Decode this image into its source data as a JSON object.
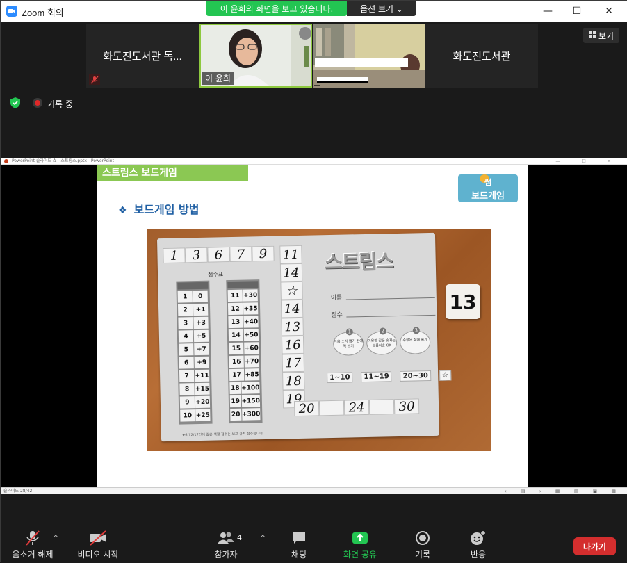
{
  "titlebar": {
    "app_title": "Zoom 회의",
    "share_banner": "이 윤희의 화면을 보고 있습니다.",
    "view_options": "옵션 보기 ⌄",
    "minimize": "—",
    "maximize": "☐",
    "close": "✕"
  },
  "gallery": {
    "view_button": "보기",
    "participants": [
      {
        "name": "화도진도서관 독..."
      },
      {
        "name": "이 윤희"
      },
      {
        "name": ""
      },
      {
        "name": "화도진도서관"
      }
    ],
    "recording_label": "기록 중"
  },
  "powerpoint": {
    "window_title": "PowerPoint 슬라이드 쇼 - 스트림스.pptx - PowerPoint",
    "status": "슬라이드 28/42",
    "slide": {
      "header": "스트림스 보드게임",
      "logo_line1": "쌤",
      "logo_line2": "보드게임",
      "subtitle": "보드게임 방법",
      "photo": {
        "sequence": [
          "1",
          "3",
          "6",
          "7",
          "9",
          "11"
        ],
        "column": [
          "14",
          "☆",
          "14",
          "13",
          "16",
          "17",
          "18",
          "19"
        ],
        "bottom": [
          "20",
          "",
          "24",
          "",
          "30"
        ],
        "title": "스트림스",
        "score_label": "점수표",
        "scores_left": [
          [
            "1",
            "0"
          ],
          [
            "2",
            "+1"
          ],
          [
            "3",
            "+3"
          ],
          [
            "4",
            "+5"
          ],
          [
            "5",
            "+7"
          ],
          [
            "6",
            "+9"
          ],
          [
            "7",
            "+11"
          ],
          [
            "8",
            "+15"
          ],
          [
            "9",
            "+20"
          ],
          [
            "10",
            "+25"
          ]
        ],
        "scores_right": [
          [
            "11",
            "+30"
          ],
          [
            "12",
            "+35"
          ],
          [
            "13",
            "+40"
          ],
          [
            "14",
            "+50"
          ],
          [
            "15",
            "+60"
          ],
          [
            "16",
            "+70"
          ],
          [
            "17",
            "+85"
          ],
          [
            "18",
            "+100"
          ],
          [
            "19",
            "+150"
          ],
          [
            "20",
            "+300"
          ]
        ],
        "field_name": "이름",
        "field_score": "점수",
        "rules": [
          {
            "num": "1",
            "text": "다음 숫자 뽑기 전에 꼭 쓰기"
          },
          {
            "num": "2",
            "text": "이웃한 같은 숫자는 오름차순 OK"
          },
          {
            "num": "3",
            "text": "수정은 절대 불가"
          }
        ],
        "range_row": [
          "1~10",
          "11~19",
          "20~30",
          "☆"
        ],
        "footnote": "★6/12/17칸에 같은 색깔 점수는 보고 규칙 점수합니다",
        "tile": "13"
      }
    }
  },
  "toolbar": {
    "unmute": "음소거 해제",
    "start_video": "비디오 시작",
    "participants": "참가자",
    "participant_count": "4",
    "chat": "채팅",
    "share_screen": "화면 공유",
    "record": "기록",
    "reactions": "반응",
    "leave": "나가기"
  },
  "colors": {
    "share_green": "#23c552",
    "leave_red": "#d42e2e",
    "slide_header_green": "#8bc853",
    "subtitle_blue": "#1f5fa3"
  }
}
